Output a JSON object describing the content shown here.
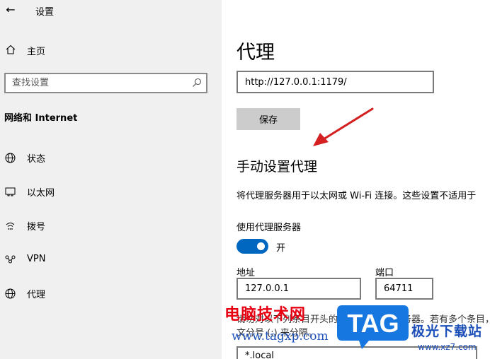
{
  "app": {
    "title": "设置"
  },
  "sidebar": {
    "home_label": "主页",
    "search_placeholder": "查找设置",
    "section_title": "网络和 Internet",
    "items": [
      {
        "label": "状态",
        "icon": "globe-icon"
      },
      {
        "label": "以太网",
        "icon": "ethernet-icon"
      },
      {
        "label": "拨号",
        "icon": "dialup-icon"
      },
      {
        "label": "VPN",
        "icon": "vpn-icon"
      },
      {
        "label": "代理",
        "icon": "globe-icon"
      }
    ]
  },
  "main": {
    "page_title": "代理",
    "script_url": "http://127.0.0.1:1179/",
    "save_label": "保存",
    "manual_title": "手动设置代理",
    "manual_desc": "将代理服务器用于以太网或 Wi-Fi 连接。这些设置不适用于",
    "use_proxy_label": "使用代理服务器",
    "toggle_state": "开",
    "address_label": "地址",
    "address_value": "127.0.0.1",
    "port_label": "端口",
    "port_value": "64711",
    "exceptions_text": "请勿对以下列条目开头的地址使用代理服务器。若有多个条目，请使用英文分号 (;) 来分隔。",
    "exceptions_value": "*.local"
  },
  "watermark": {
    "site_name": "电脑技术网",
    "site_url": "www.tagxp.com",
    "logo_text": "TAG",
    "brand_name": "极光下载站",
    "brand_url": "www.xz7.com"
  },
  "colors": {
    "sidebar_bg": "#f0f0f0",
    "accent": "#0067c0",
    "button_bg": "#cccccc",
    "arrow": "#d42020",
    "watermark_red": "#e60012",
    "watermark_blue": "#1c4fb8"
  }
}
